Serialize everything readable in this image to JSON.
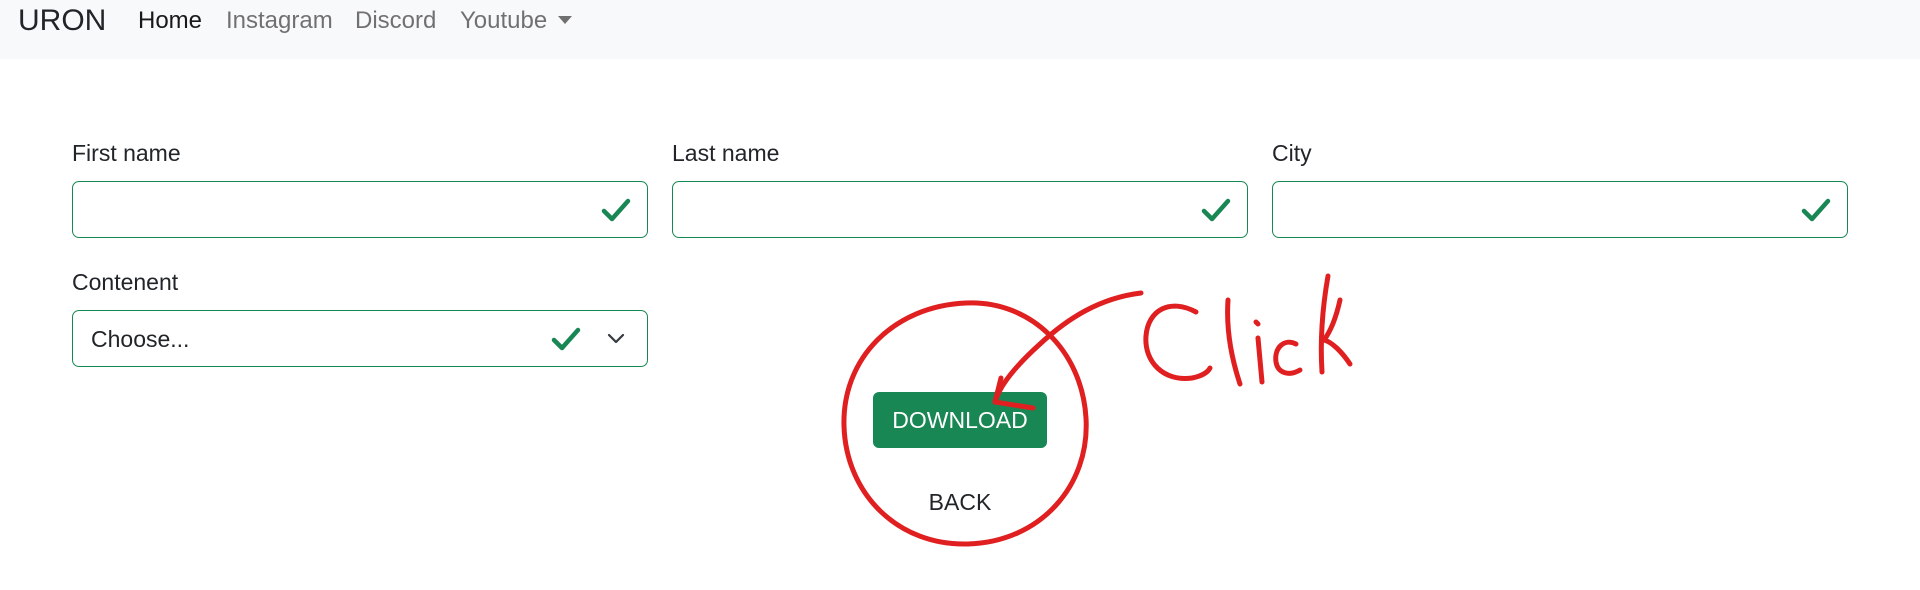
{
  "navbar": {
    "brand": "URON",
    "links": [
      {
        "label": "Home",
        "active": true
      },
      {
        "label": "Instagram",
        "active": false
      },
      {
        "label": "Discord",
        "active": false
      },
      {
        "label": "Youtube",
        "active": false,
        "dropdown": true
      }
    ]
  },
  "form": {
    "first_name": {
      "label": "First name",
      "value": "",
      "valid": true
    },
    "last_name": {
      "label": "Last name",
      "value": "",
      "valid": true
    },
    "city": {
      "label": "City",
      "value": "",
      "valid": true
    },
    "content": {
      "label": "Contenent",
      "selected": "Choose...",
      "valid": true
    }
  },
  "actions": {
    "download_label": "DOWNLOAD",
    "back_label": "BACK"
  },
  "annotation": {
    "text": "Click",
    "color": "#e02020"
  },
  "colors": {
    "success": "#198754",
    "navbar_bg": "#f8f9fa"
  }
}
